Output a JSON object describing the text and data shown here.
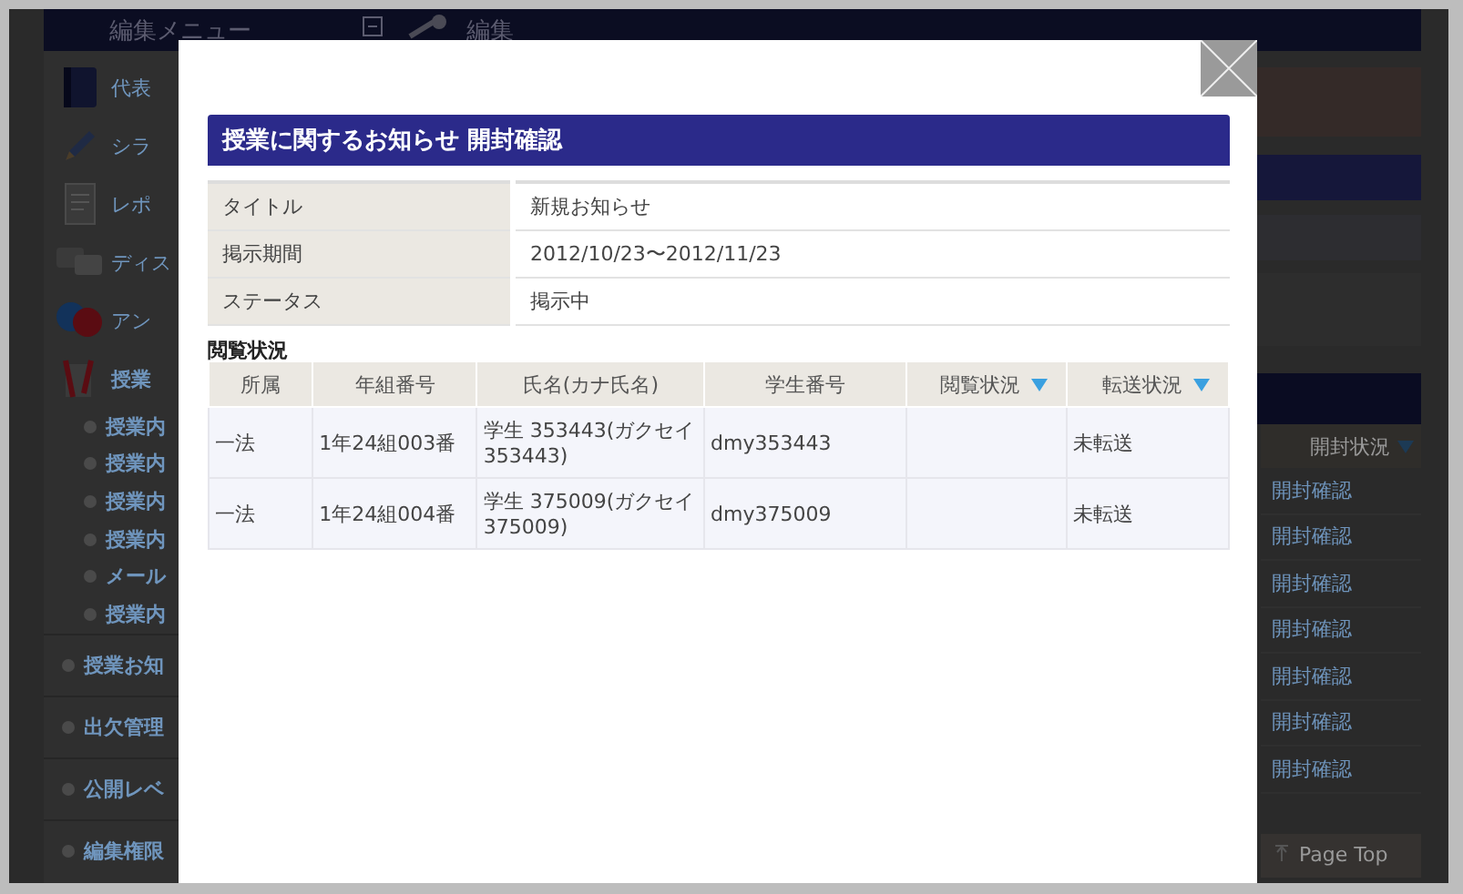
{
  "background": {
    "header": {
      "menu_title": "編集メニュー",
      "section_title": "編集"
    },
    "sidebar": {
      "items": [
        {
          "label": "代表"
        },
        {
          "label": "シラ"
        },
        {
          "label": "レポ"
        },
        {
          "label": "ディス"
        },
        {
          "label": "アン"
        },
        {
          "label": "授業"
        }
      ],
      "sub_items": [
        {
          "label": "授業内"
        },
        {
          "label": "授業内"
        },
        {
          "label": "授業内"
        },
        {
          "label": "授業内"
        },
        {
          "label": "メール"
        },
        {
          "label": "授業内"
        }
      ],
      "sections": [
        {
          "label": "授業お知"
        },
        {
          "label": "出欠管理"
        },
        {
          "label": "公開レベ"
        },
        {
          "label": "編集権限"
        }
      ]
    },
    "list": {
      "column_header": "開封状況",
      "links": [
        "開封確認",
        "開封確認",
        "開封確認",
        "開封確認",
        "開封確認",
        "開封確認",
        "開封確認"
      ],
      "page_top": "Page Top"
    }
  },
  "modal": {
    "title": "授業に関するお知らせ 開封確認",
    "info": [
      {
        "label": "タイトル",
        "value": "新規お知らせ"
      },
      {
        "label": "掲示期間",
        "value": "2012/10/23〜2012/11/23"
      },
      {
        "label": "ステータス",
        "value": "掲示中"
      }
    ],
    "section_title": "閲覧状況",
    "table": {
      "columns": [
        {
          "label": "所属",
          "filter": false
        },
        {
          "label": "年組番号",
          "filter": false
        },
        {
          "label": "氏名(カナ氏名)",
          "filter": false
        },
        {
          "label": "学生番号",
          "filter": false
        },
        {
          "label": "閲覧状況",
          "filter": true
        },
        {
          "label": "転送状況",
          "filter": true
        }
      ],
      "rows": [
        [
          "一法",
          "1年24組003番",
          "学生 353443(ガクセイ 353443)",
          "dmy353443",
          "",
          "未転送"
        ],
        [
          "一法",
          "1年24組004番",
          "学生 375009(ガクセイ 375009)",
          "dmy375009",
          "",
          "未転送"
        ]
      ]
    }
  }
}
